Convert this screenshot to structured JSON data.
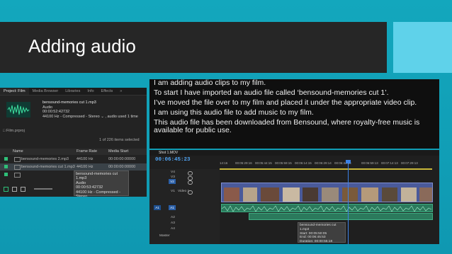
{
  "slide": {
    "title": "Adding audio",
    "colors": {
      "background": "#129fb6",
      "title_band": "#262626",
      "accent": "#5fd2ea"
    }
  },
  "text_box": {
    "lines": [
      "I am adding audio clips to my film.",
      "To start I have imported an audio file called ‘bensound-memories cut 1’.",
      "I’ve moved the file over to my film and placed it under the appropriate video clip.",
      "I am using this audio file to add music to my film.",
      "This audio file has been downloaded from Bensound, where royalty-free music is available for public use."
    ]
  },
  "project_panel": {
    "tabs": [
      "Project: Film",
      "Media Browser",
      "Libraries",
      "Info",
      "Effects",
      "»"
    ],
    "preview": {
      "name": "bensound-memories cut 1.mp3",
      "type": "Audio",
      "duration": "00:00:52:42732",
      "format": "44100 Hz - Compressed - Stereo",
      "usage": ", audio used 1 time"
    },
    "project_file": "Film.prproj",
    "items_selected": "1 of 226 items selected",
    "columns": [
      "Name",
      "Frame Rate",
      "Media Start"
    ],
    "rows": [
      {
        "name": "bensound-memories 2.mp3",
        "frame_rate": "44100 Hz",
        "media_start": "00:00:00:00000"
      },
      {
        "name": "bensound-memories cut 1.mp3",
        "frame_rate": "44100 Hz",
        "media_start": "00:00:00:00000"
      },
      {
        "name": "",
        "frame_rate": "",
        "media_start": ""
      }
    ],
    "tooltip": {
      "name": "bensound-memories cut 1.mp3",
      "type": "Audio",
      "duration": "00:00:53:42732",
      "format": "44100 Hz - Compressed - Stereo"
    }
  },
  "timeline_panel": {
    "sequence": "Shot 1.MOV",
    "timecode": "00:06:45:23",
    "ruler": [
      "14:16",
      "00:05:29:16",
      "00:05:44:15",
      "00:05:59:15",
      "00:06:14:15",
      "00:06:29:14",
      "00:06:44:14",
      "00:06:59:13",
      "00:07:14:13",
      "00:07:29:13"
    ],
    "tracks": {
      "video": [
        "V4",
        "V3",
        "V2",
        "V1"
      ],
      "audio": [
        "A1",
        "A2",
        "A3",
        "A4"
      ],
      "video1_label": "Video 1",
      "master": "Master"
    },
    "tooltip": {
      "name": "bensound-memories cut 1.mp3",
      "start": "Start: 00:05:50:05",
      "end": "End: 00:06:45:53",
      "duration": "Duration: 00:00:55:18"
    }
  }
}
